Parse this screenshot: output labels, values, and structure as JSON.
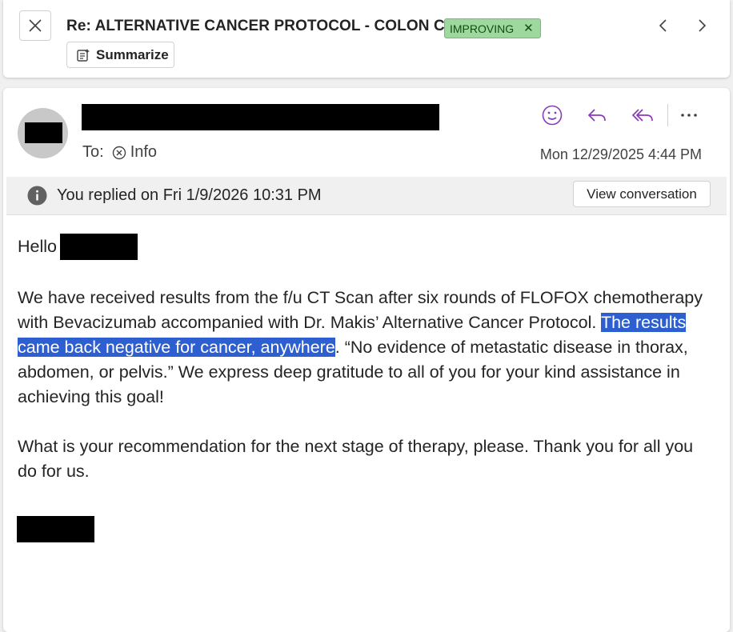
{
  "header": {
    "subject": "Re: ALTERNATIVE CANCER PROTOCOL - COLON CA",
    "tag_label": "IMPROVING",
    "tag_color": "#9fd89f",
    "summarize_label": "Summarize",
    "icons": [
      "close-icon",
      "chevron-left-icon",
      "chevron-right-icon",
      "summarize-icon",
      "tag-remove-icon"
    ]
  },
  "message": {
    "to_label": "To:",
    "recipient": "Info",
    "date": "Mon 12/29/2025 4:44 PM",
    "action_icons": [
      "emoji-icon",
      "reply-icon",
      "reply-all-icon",
      "more-icon"
    ],
    "accent_color": "#8a3ab9"
  },
  "info_bar": {
    "text": "You replied on Fri 1/9/2026 10:31 PM",
    "view_conversation_label": "View conversation"
  },
  "body": {
    "greeting": "Hello",
    "p1_before": "We have received results from the f/u CT Scan after six rounds of FLOFOX chemotherapy with Bevacizumab accompanied with Dr. Makis’ Alternative Cancer Protocol.  ",
    "p1_highlight": "The results came back negative for cancer, anywhere",
    "p1_after": ".  “No evidence of metastatic disease in thorax, abdomen, or pelvis.”  We express deep gratitude to all of you for your kind assistance in achieving this goal!",
    "p2": "What is your recommendation for the next stage of therapy, please.  Thank you for all you do for us.",
    "highlight_color": "#2d5fd1"
  }
}
